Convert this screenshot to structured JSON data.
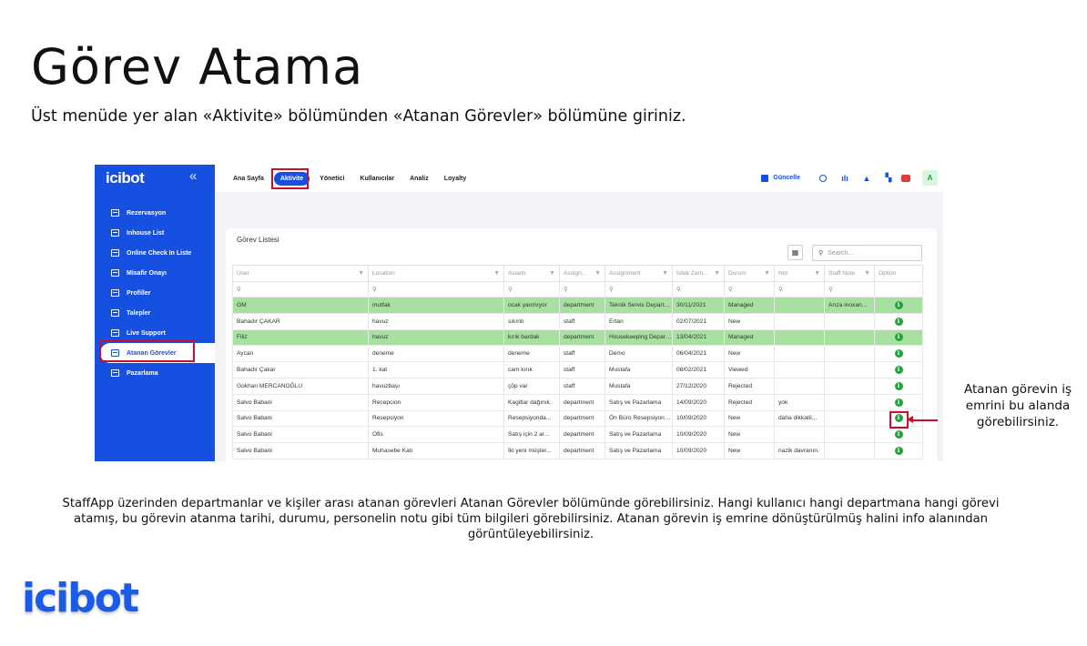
{
  "slide": {
    "title": "Görev Atama",
    "subtitle": "Üst menüde yer alan «Aktivite» bölümünden «Atanan Görevler» bölümüne giriniz.",
    "callout": "Atanan görevin iş emrini bu alanda görebilirsiniz.",
    "description": "StaffApp üzerinden departmanlar ve kişiler arası atanan görevleri Atanan Görevler bölümünde görebilirsiniz. Hangi kullanıcı hangi departmana hangi görevi atamış, bu görevin atanma tarihi, durumu, personelin notu gibi tüm bilgileri görebilirsiniz. Atanan görevin iş emrine dönüştürülmüş halini info alanından görüntüleyebilirsiniz.",
    "footer_logo": "icibot",
    "highlight_color": "#c8102e"
  },
  "app": {
    "logo": "icibot",
    "collapse_icon": "double-chevron-left-icon",
    "sidebar": {
      "items": [
        {
          "label": "Rezervasyon",
          "icon": "calendar-icon"
        },
        {
          "label": "Inhouse List",
          "icon": "calendar-icon"
        },
        {
          "label": "Online Check In Liste",
          "icon": "calendar-icon"
        },
        {
          "label": "Misafir Onayı",
          "icon": "calendar-icon"
        },
        {
          "label": "Profiller",
          "icon": "calendar-icon"
        },
        {
          "label": "Talepler",
          "icon": "calendar-icon"
        },
        {
          "label": "Live Support",
          "icon": "calendar-icon"
        },
        {
          "label": "Atanan Görevler",
          "icon": "calendar-icon",
          "active": true
        },
        {
          "label": "Pazarlama",
          "icon": "calendar-icon"
        }
      ]
    },
    "topbar": {
      "menu": [
        "Ana Sayfa",
        "Aktivite",
        "Yönetici",
        "Kullanıcılar",
        "Analiz",
        "Loyalty"
      ],
      "active_menu": "Aktivite",
      "save_label": "Güncelle",
      "avatar": "A"
    },
    "accent_color": "#1650e0",
    "task_list": {
      "title": "Görev Listesi",
      "search_placeholder": "Search...",
      "columns": [
        "User",
        "Location",
        "Assets",
        "Assign...",
        "Assignment",
        "İstek Zam...",
        "Durum",
        "Not",
        "Staff Note",
        "Option"
      ],
      "rows": [
        [
          "GM",
          "mutfak",
          "ocak yanmıyor",
          "department",
          "Teknik Servis Departmanı",
          "30/11/2021",
          "Managed",
          "",
          "Arıza inoxan...",
          "info"
        ],
        [
          "Bahadır ÇAKAR",
          "havuz",
          "sıkıntı",
          "staff",
          "Ertan",
          "02/07/2021",
          "New",
          "",
          "",
          "info"
        ],
        [
          "Filiz",
          "havuz",
          "kırık bardak",
          "department",
          "Housekeeping Departmanı",
          "13/04/2021",
          "Managed",
          "",
          "",
          "info"
        ],
        [
          "Aycan",
          "deneme",
          "deneme",
          "staff",
          "Demo",
          "06/04/2021",
          "New",
          "",
          "",
          "info"
        ],
        [
          "Bahadır Çakar",
          "1. kat",
          "cam kırık",
          "staff",
          "Mustafa",
          "08/02/2021",
          "Viewed",
          "",
          "",
          "info"
        ],
        [
          "Gokhan MERCANOĞLU",
          "havuzbaşı",
          "çöp var",
          "staff",
          "Mustafa",
          "27/12/2020",
          "Rejected",
          "",
          "",
          "info"
        ],
        [
          "Salvo Babani",
          "Recepcion",
          "Kagitlar dağınık.",
          "department",
          "Satış ve Pazarlama",
          "14/09/2020",
          "Rejected",
          "yok",
          "",
          "info"
        ],
        [
          "Salvo Babani",
          "Resepsiyon",
          "Resepsiyonda...",
          "department",
          "Ön Büro Resepsiyon Departmanı",
          "10/09/2020",
          "New",
          "daha dikkatli...",
          "",
          "info"
        ],
        [
          "Salvo Babani",
          "Ofis",
          "Satış için 2 ar...",
          "department",
          "Satış ve Pazarlama",
          "10/09/2020",
          "New",
          "",
          "",
          "info"
        ],
        [
          "Salvo Babani",
          "Muhasebe Katı",
          "İki yeni müşter...",
          "department",
          "Satış ve Pazarlama",
          "10/09/2020",
          "New",
          "nazik davranın.",
          "",
          "info"
        ]
      ],
      "highlighted_rows": [
        0,
        2
      ],
      "highlight_row_color": "#a8e0a2"
    }
  }
}
